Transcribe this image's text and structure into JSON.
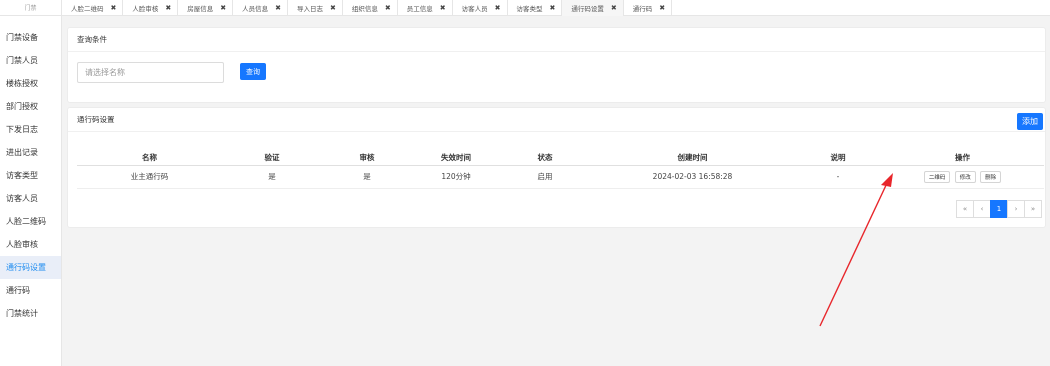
{
  "sidebar": {
    "header": "门禁",
    "items": [
      {
        "label": "门禁设备"
      },
      {
        "label": "门禁人员"
      },
      {
        "label": "楼栋授权"
      },
      {
        "label": "部门授权"
      },
      {
        "label": "下发日志"
      },
      {
        "label": "进出记录"
      },
      {
        "label": "访客类型"
      },
      {
        "label": "访客人员"
      },
      {
        "label": "人脸二维码"
      },
      {
        "label": "人脸审核"
      },
      {
        "label": "通行码设置"
      },
      {
        "label": "通行码"
      },
      {
        "label": "门禁统计"
      }
    ],
    "active_index": 10
  },
  "tabs": [
    {
      "label": "人脸二维码",
      "close": "✖"
    },
    {
      "label": "人脸审核",
      "close": "✖"
    },
    {
      "label": "房屋信息",
      "close": "✖"
    },
    {
      "label": "人员信息",
      "close": "✖"
    },
    {
      "label": "导入日志",
      "close": "✖"
    },
    {
      "label": "组织信息",
      "close": "✖"
    },
    {
      "label": "员工信息",
      "close": "✖"
    },
    {
      "label": "访客人员",
      "close": "✖"
    },
    {
      "label": "访客类型",
      "close": "✖"
    },
    {
      "label": "通行码设置",
      "close": "✖"
    },
    {
      "label": "通行码",
      "close": "✖"
    }
  ],
  "query": {
    "title": "查询条件",
    "input_placeholder": "请选择名称",
    "search_label": "查询"
  },
  "list": {
    "title": "通行码设置",
    "add_label": "添加",
    "columns": [
      "名称",
      "验证",
      "审核",
      "失效时间",
      "状态",
      "创建时间",
      "说明",
      "操作"
    ],
    "rows": [
      {
        "name": "业主通行码",
        "verify": "是",
        "audit": "是",
        "expire": "120分钟",
        "status": "启用",
        "created": "2024-02-03 16:58:28",
        "note": "-",
        "actions": [
          "二维码",
          "修改",
          "删除"
        ]
      }
    ]
  },
  "pagination": {
    "first": "«",
    "prev": "‹",
    "current": "1",
    "next": "›",
    "last": "»"
  },
  "annotation_color": "#e8262b"
}
